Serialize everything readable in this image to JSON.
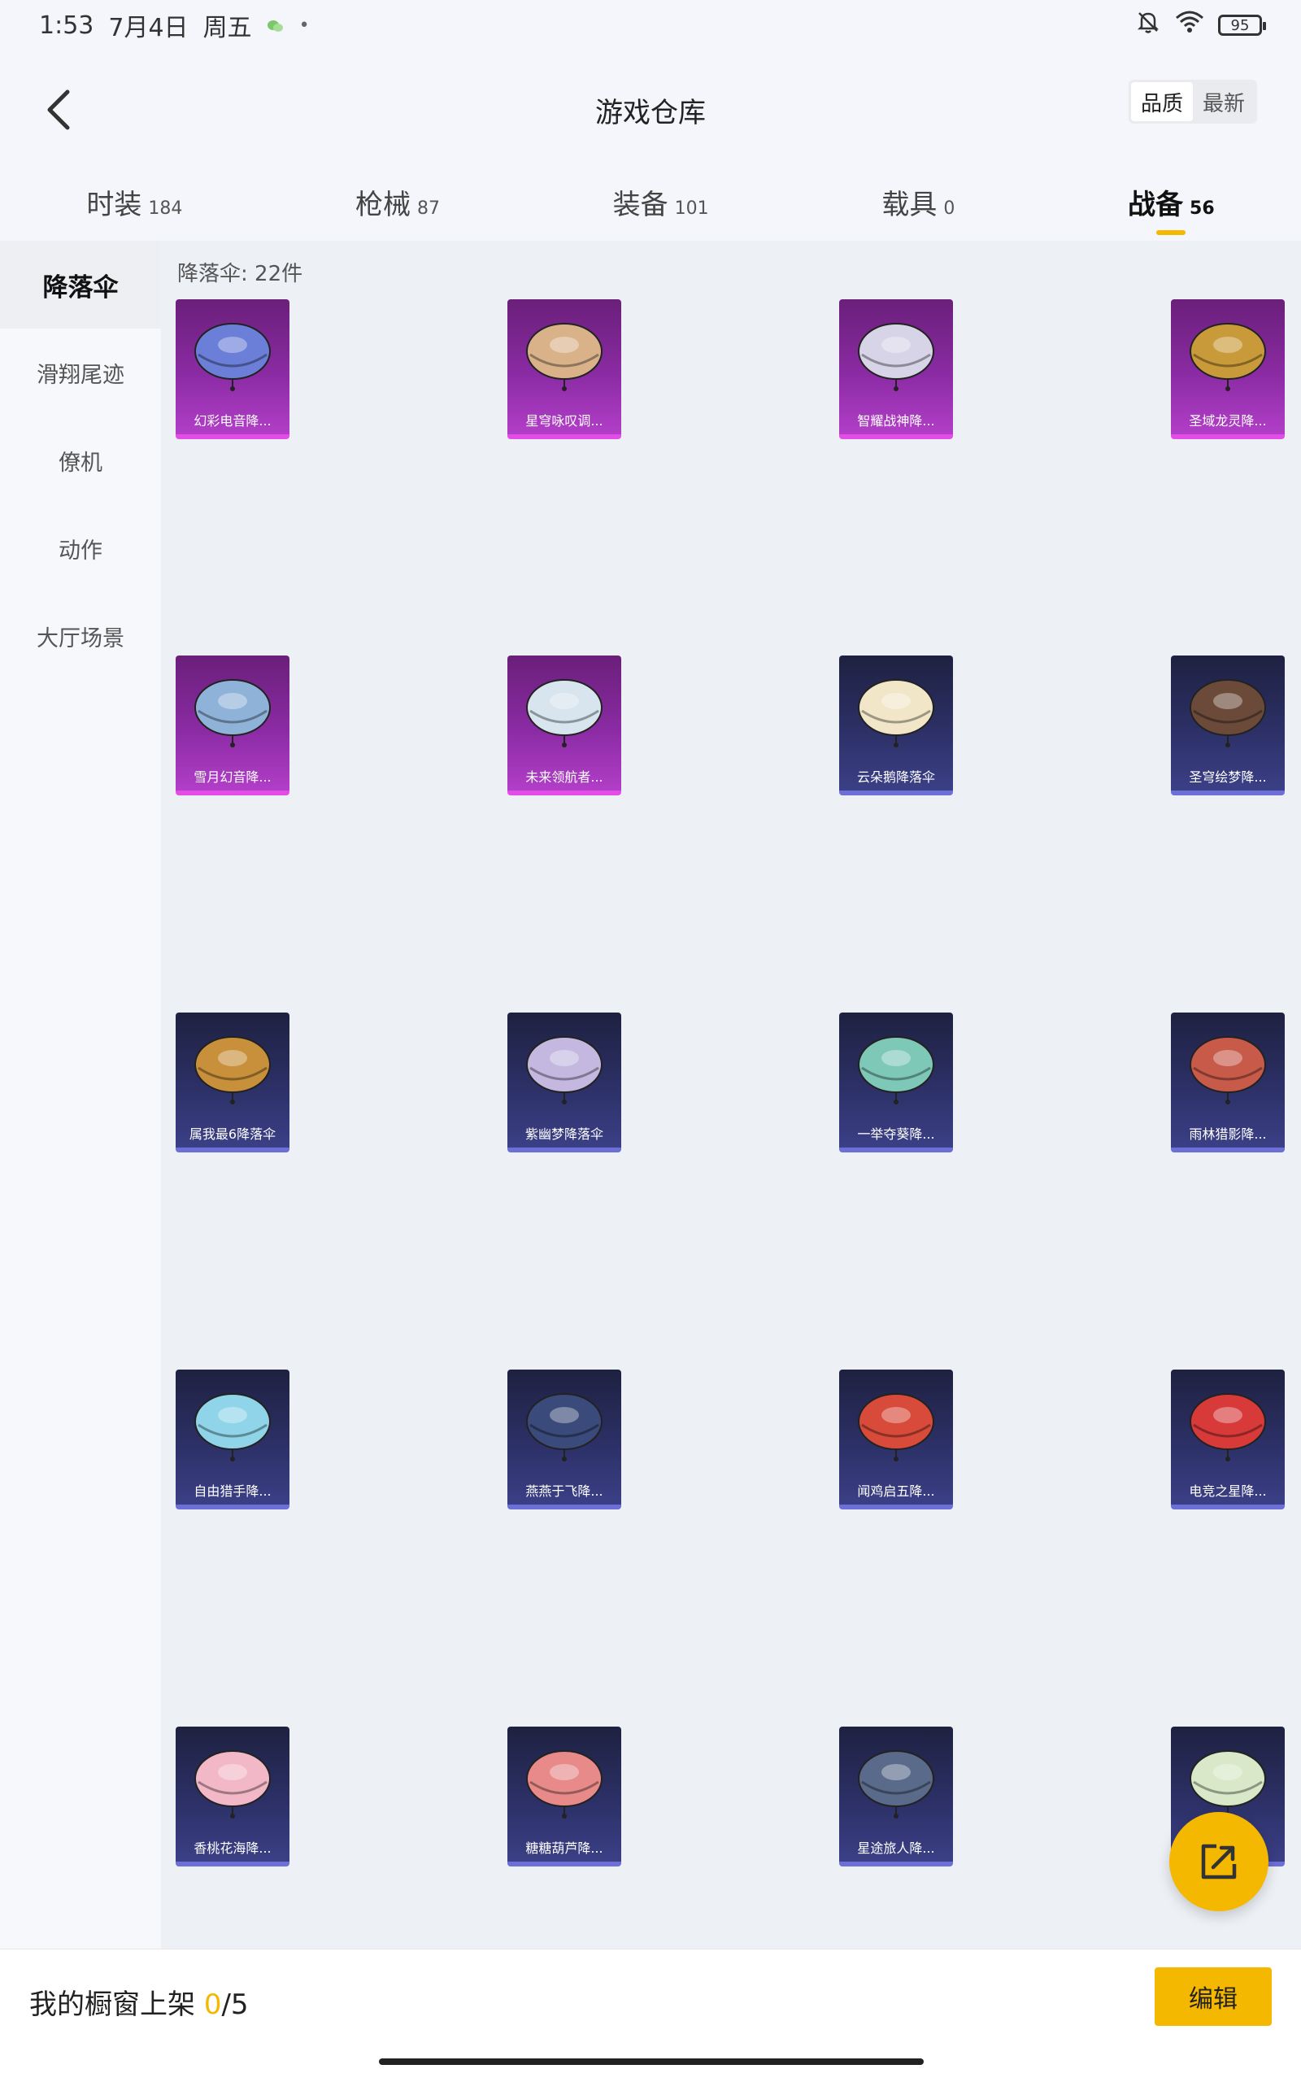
{
  "status": {
    "time": "1:53",
    "date": "7月4日",
    "weekday": "周五",
    "battery": "95"
  },
  "header": {
    "title": "游戏仓库",
    "sort": {
      "quality": "品质",
      "newest": "最新"
    }
  },
  "tabs": [
    {
      "label": "时装",
      "count": "184"
    },
    {
      "label": "枪械",
      "count": "87"
    },
    {
      "label": "装备",
      "count": "101"
    },
    {
      "label": "载具",
      "count": "0"
    },
    {
      "label": "战备",
      "count": "56"
    }
  ],
  "sidebar": {
    "items": [
      {
        "label": "降落伞"
      },
      {
        "label": "滑翔尾迹"
      },
      {
        "label": "僚机"
      },
      {
        "label": "动作"
      },
      {
        "label": "大厅场景"
      }
    ]
  },
  "content": {
    "count_label": "降落伞: 22件",
    "items": [
      {
        "name": "幻彩电音降...",
        "rarity": "purple",
        "color": "#6b7fd8"
      },
      {
        "name": "星穹咏叹调...",
        "rarity": "purple",
        "color": "#d9b28a"
      },
      {
        "name": "智耀战神降...",
        "rarity": "purple",
        "color": "#d8d4e8"
      },
      {
        "name": "圣域龙灵降...",
        "rarity": "purple",
        "color": "#c99a3a"
      },
      {
        "name": "雪月幻音降...",
        "rarity": "purple",
        "color": "#8fb3d8"
      },
      {
        "name": "未来领航者...",
        "rarity": "purple",
        "color": "#d8e4ee"
      },
      {
        "name": "云朵鹅降落伞",
        "rarity": "blue",
        "color": "#f2e6c8"
      },
      {
        "name": "圣穹绘梦降...",
        "rarity": "blue",
        "color": "#6b4a3a"
      },
      {
        "name": "属我最6降落伞",
        "rarity": "blue",
        "color": "#c8903a"
      },
      {
        "name": "紫幽梦降落伞",
        "rarity": "blue",
        "color": "#c4b8e0"
      },
      {
        "name": "一举夺葵降...",
        "rarity": "blue",
        "color": "#7ec8b8"
      },
      {
        "name": "雨林猎影降...",
        "rarity": "blue",
        "color": "#c85a4a"
      },
      {
        "name": "自由猎手降...",
        "rarity": "blue",
        "color": "#8fd4e8"
      },
      {
        "name": "燕燕于飞降...",
        "rarity": "blue",
        "color": "#3a4a7a"
      },
      {
        "name": "闻鸡启五降...",
        "rarity": "blue",
        "color": "#d84a3a"
      },
      {
        "name": "电竞之星降...",
        "rarity": "blue",
        "color": "#d83a3a"
      },
      {
        "name": "香桃花海降...",
        "rarity": "blue",
        "color": "#f2b8c8"
      },
      {
        "name": "糖糖葫芦降...",
        "rarity": "blue",
        "color": "#e88a8a"
      },
      {
        "name": "星途旅人降...",
        "rarity": "blue",
        "color": "#5a6a8a"
      },
      {
        "name": "",
        "rarity": "blue",
        "color": "#d8e8c8"
      }
    ]
  },
  "bottom": {
    "shelf_label": "我的橱窗上架",
    "shelf_current": "0",
    "shelf_total": "/5",
    "edit_label": "编辑"
  },
  "colors": {
    "accent": "#f5b800",
    "purple_card": "#8a2ba3",
    "blue_card": "#2c3066"
  }
}
